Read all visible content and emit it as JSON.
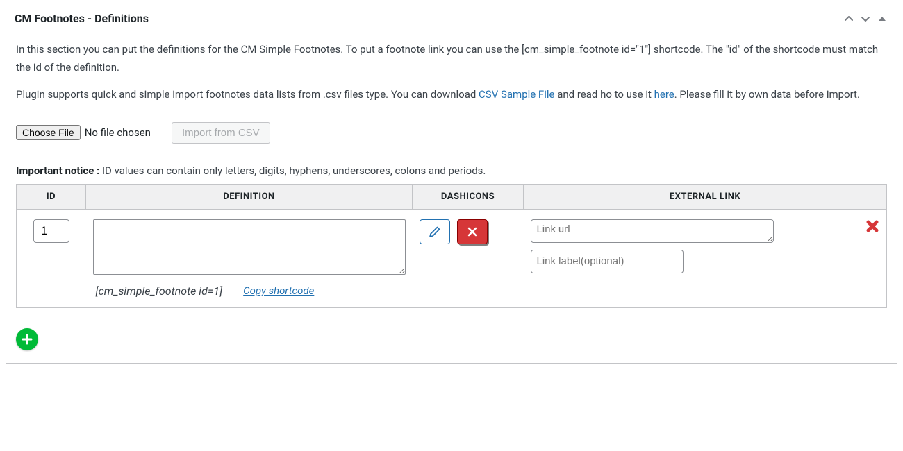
{
  "metabox": {
    "title": "CM Footnotes - Definitions"
  },
  "intro": {
    "p1": "In this section you can put the definitions for the CM Simple Footnotes. To put a footnote link you can use the [cm_simple_footnote id=\"1\"] shortcode. The \"id\" of the shortcode must match the id of the definition.",
    "p2a": "Plugin supports quick and simple import footnotes data lists from .csv files type.  You can download ",
    "link_csv": "CSV Sample File",
    "p2b": "  and read ho to use it ",
    "link_here": "here",
    "p2c": ".  Please fill it by own data before import."
  },
  "upload": {
    "choose_label": "Choose File",
    "no_file": "No file chosen",
    "import_label": "Import from CSV"
  },
  "notice": {
    "label": "Important notice :",
    "text": " ID values can contain only letters, digits, hyphens, underscores, colons and periods."
  },
  "table": {
    "headers": {
      "id": "ID",
      "definition": "DEFINITION",
      "dashicons": "DASHICONS",
      "external_link": "EXTERNAL LINK"
    },
    "row": {
      "id_value": "1",
      "definition_value": "",
      "shortcode": "[cm_simple_footnote id=1]",
      "copy_label": "Copy shortcode",
      "link_url_value": "",
      "link_url_placeholder": "Link url",
      "link_label_value": "",
      "link_label_placeholder": "Link label(optional)"
    }
  }
}
